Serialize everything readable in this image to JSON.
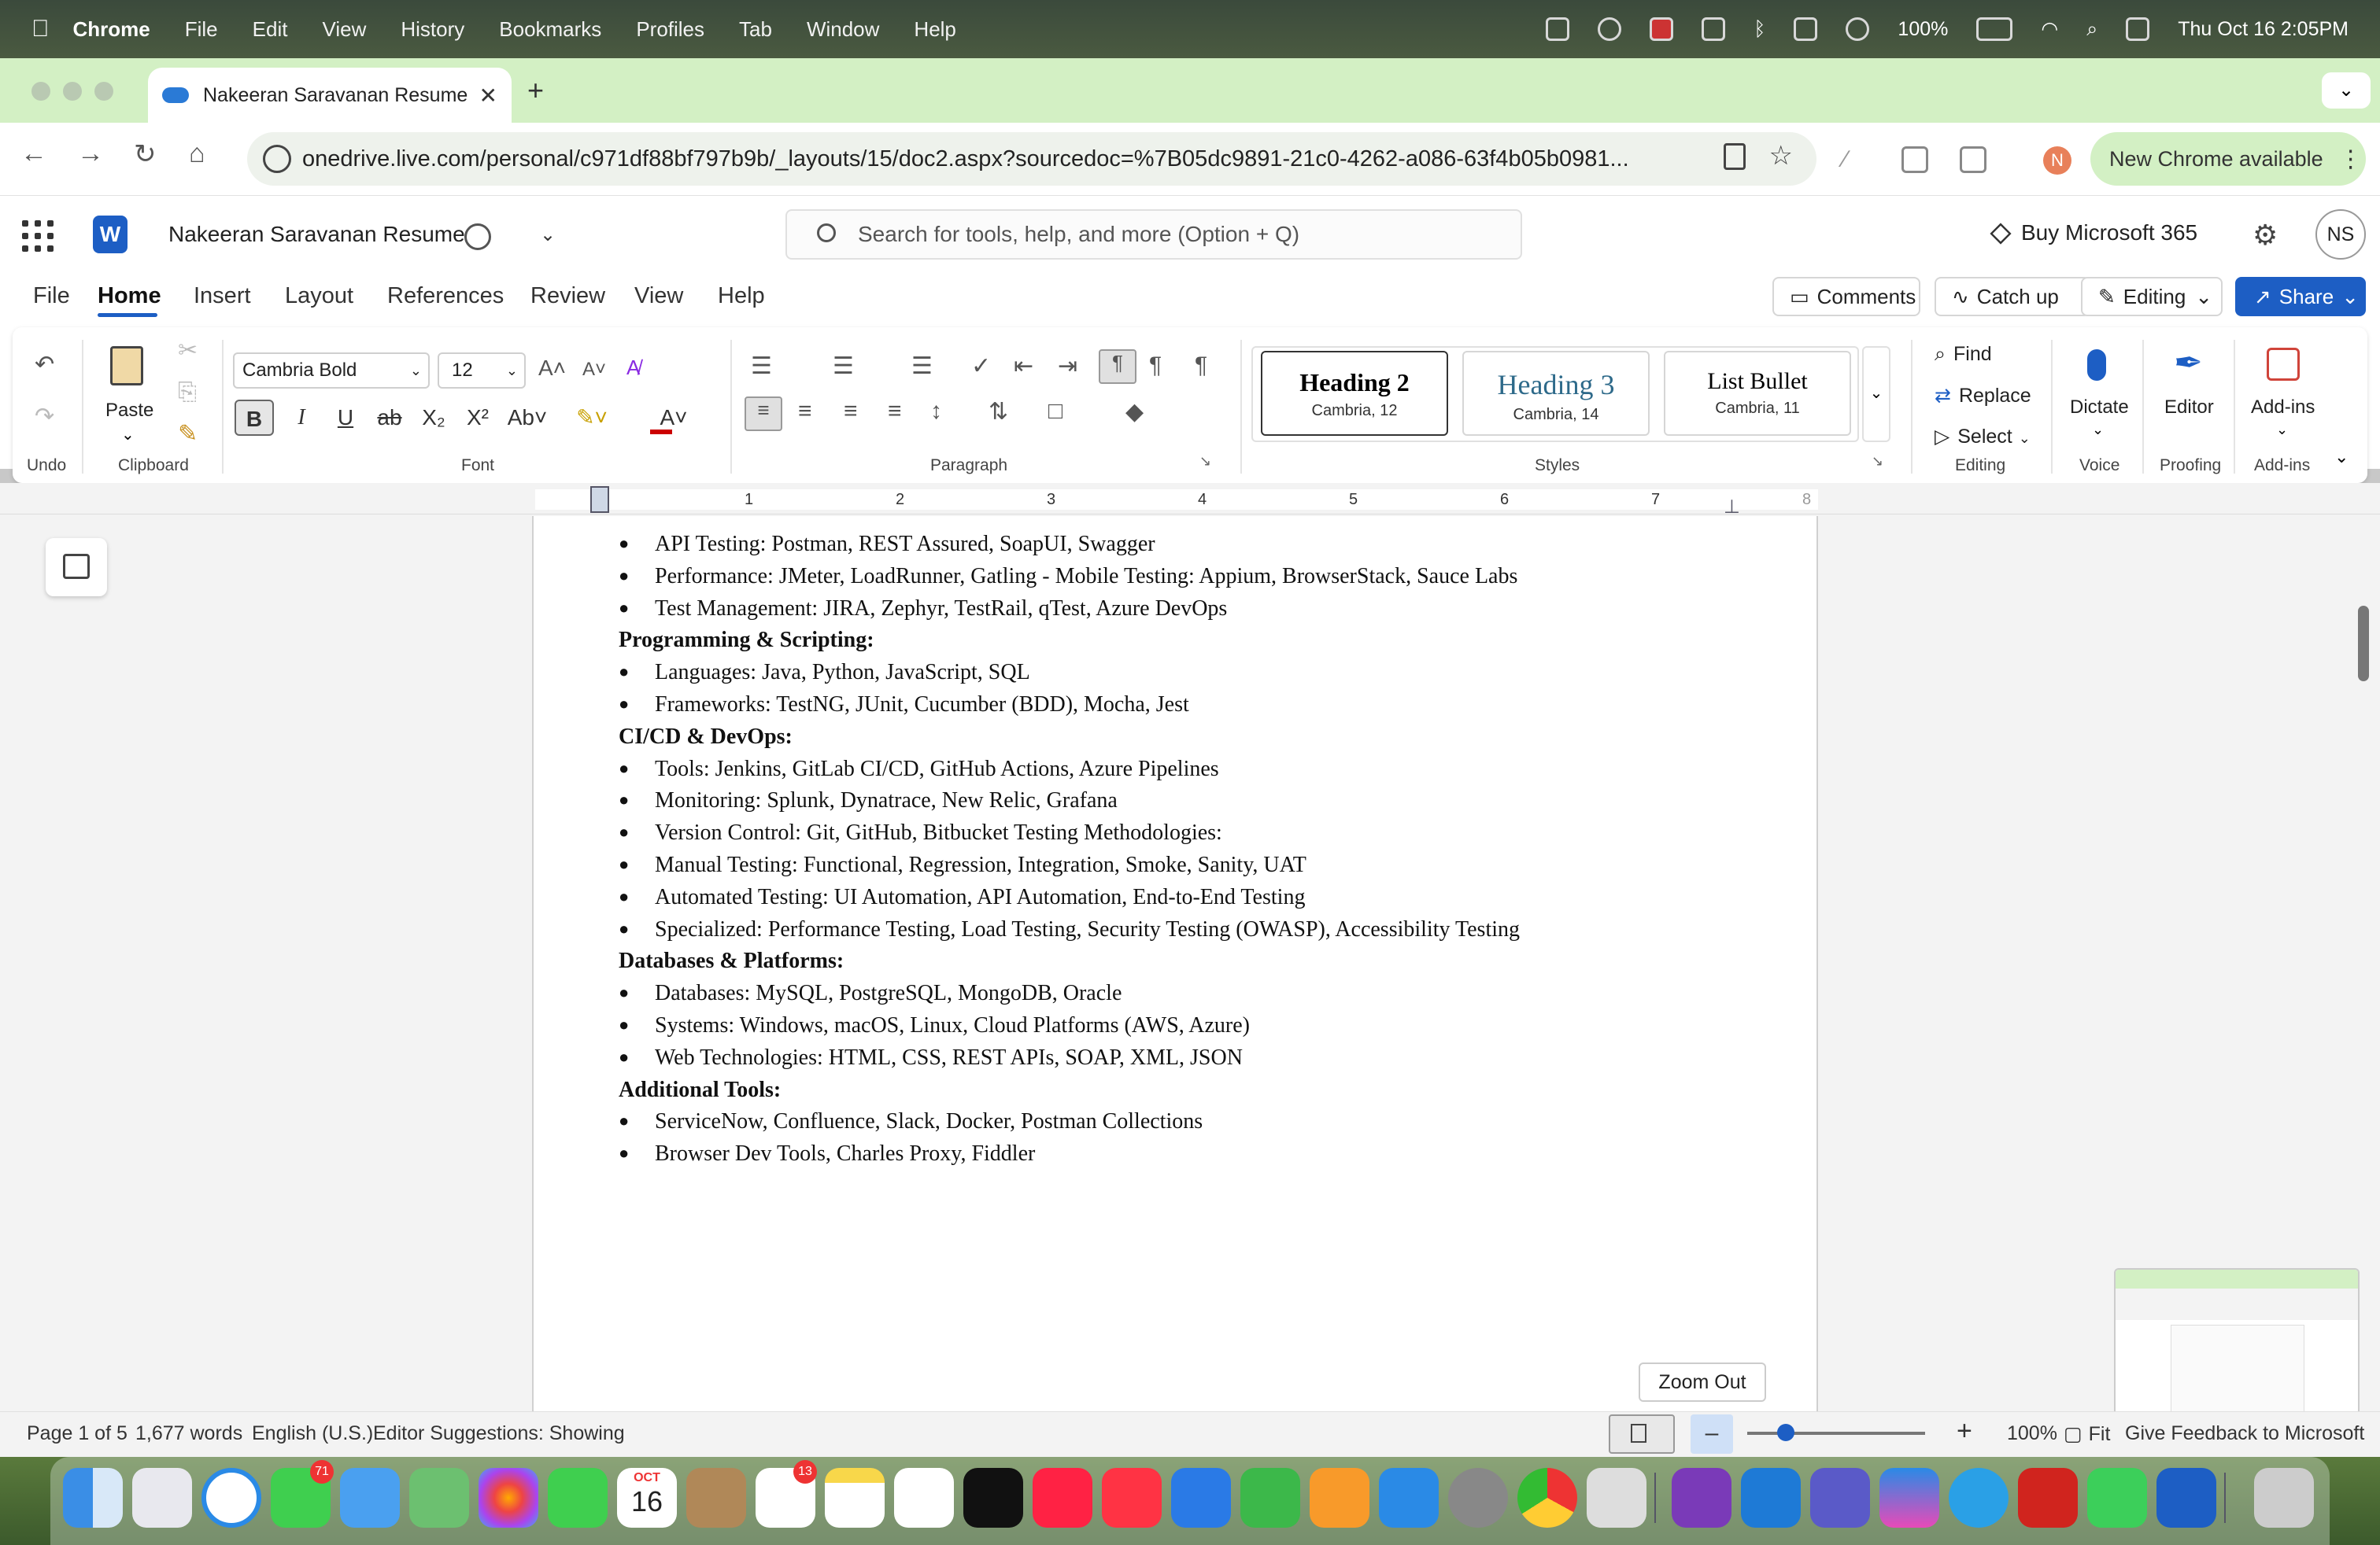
{
  "menubar": {
    "app": "Chrome",
    "items": [
      "File",
      "Edit",
      "View",
      "History",
      "Bookmarks",
      "Profiles",
      "Tab",
      "Window",
      "Help"
    ],
    "battery": "100%",
    "datetime": "Thu Oct 16  2:05PM"
  },
  "browser": {
    "tab_title": "Nakeeran Saravanan Resume",
    "url": "onedrive.live.com/personal/c971df88bf797b9b/_layouts/15/doc2.aspx?sourcedoc=%7B05dc9891-21c0-4262-a086-63f4b05b0981...",
    "new_chrome": "New Chrome available",
    "profile_initial": "N"
  },
  "word": {
    "doc_name": "Nakeeran Saravanan Resume",
    "search_placeholder": "Search for tools, help, and more (Option + Q)",
    "buy": "Buy Microsoft 365",
    "avatar": "NS",
    "tabs": [
      "File",
      "Home",
      "Insert",
      "Layout",
      "References",
      "Review",
      "View",
      "Help"
    ],
    "comments": "Comments",
    "catch_up": "Catch up",
    "editing": "Editing",
    "share": "Share"
  },
  "ribbon": {
    "undo_label": "Undo",
    "paste": "Paste",
    "clipboard_label": "Clipboard",
    "font_name": "Cambria Bold",
    "font_size": "12",
    "font_label": "Font",
    "paragraph_label": "Paragraph",
    "styles": [
      {
        "name": "Heading 2",
        "sub": "Cambria, 12"
      },
      {
        "name": "Heading 3",
        "sub": "Cambria, 14"
      },
      {
        "name": "List Bullet",
        "sub": "Cambria, 11"
      }
    ],
    "styles_label": "Styles",
    "find": "Find",
    "replace": "Replace",
    "select": "Select",
    "editing_label": "Editing",
    "dictate": "Dictate",
    "voice_label": "Voice",
    "editor": "Editor",
    "proofing_label": "Proofing",
    "addins": "Add-ins",
    "addins_label": "Add-ins"
  },
  "ruler": [
    "1",
    "2",
    "3",
    "4",
    "5",
    "6",
    "7",
    "8"
  ],
  "document": {
    "lines": [
      {
        "type": "bullet",
        "text": "API Testing: Postman, REST Assured, SoapUI, Swagger"
      },
      {
        "type": "bullet",
        "text": "Performance: JMeter, LoadRunner, Gatling - Mobile Testing: Appium, BrowserStack, Sauce Labs"
      },
      {
        "type": "bullet",
        "text": "Test Management: JIRA, Zephyr, TestRail, qTest, Azure DevOps"
      },
      {
        "type": "heading",
        "text": "Programming & Scripting:"
      },
      {
        "type": "bullet",
        "text": "Languages: Java, Python, JavaScript, SQL"
      },
      {
        "type": "bullet",
        "text": "Frameworks: TestNG, JUnit, Cucumber (BDD), Mocha, Jest"
      },
      {
        "type": "heading",
        "text": "CI/CD & DevOps:"
      },
      {
        "type": "bullet",
        "text": "Tools: Jenkins, GitLab CI/CD, GitHub Actions, Azure Pipelines"
      },
      {
        "type": "bullet",
        "text": "Monitoring: Splunk, Dynatrace, New Relic, Grafana"
      },
      {
        "type": "bullet",
        "text": "Version Control: Git, GitHub, Bitbucket Testing Methodologies:"
      },
      {
        "type": "bullet",
        "text": "Manual Testing: Functional, Regression, Integration, Smoke, Sanity, UAT"
      },
      {
        "type": "bullet",
        "text": "Automated Testing: UI Automation, API Automation, End-to-End Testing"
      },
      {
        "type": "bullet",
        "text": "Specialized: Performance Testing, Load Testing, Security Testing (OWASP), Accessibility Testing"
      },
      {
        "type": "heading",
        "text": "Databases & Platforms:"
      },
      {
        "type": "bullet",
        "text": "Databases: MySQL, PostgreSQL, MongoDB, Oracle"
      },
      {
        "type": "bullet",
        "text": "Systems: Windows, macOS, Linux, Cloud Platforms (AWS, Azure)"
      },
      {
        "type": "bullet",
        "text": "Web Technologies: HTML, CSS, REST APIs, SOAP, XML, JSON"
      },
      {
        "type": "heading",
        "text": "Additional Tools:"
      },
      {
        "type": "bullet",
        "text": "ServiceNow, Confluence, Slack, Docker, Postman Collections"
      },
      {
        "type": "bullet",
        "text": "Browser Dev Tools, Charles Proxy, Fiddler"
      }
    ]
  },
  "tooltip": "Zoom Out",
  "status": {
    "page": "Page 1 of 5",
    "words": "1,677 words",
    "language": "English (U.S.)",
    "suggestions": "Editor Suggestions: Showing",
    "zoom": "100%",
    "fit": "Fit",
    "feedback": "Give Feedback to Microsoft"
  },
  "dock": {
    "date_month": "OCT",
    "date_day": "16",
    "messages_badge": "71",
    "reminders_badge": "13"
  }
}
